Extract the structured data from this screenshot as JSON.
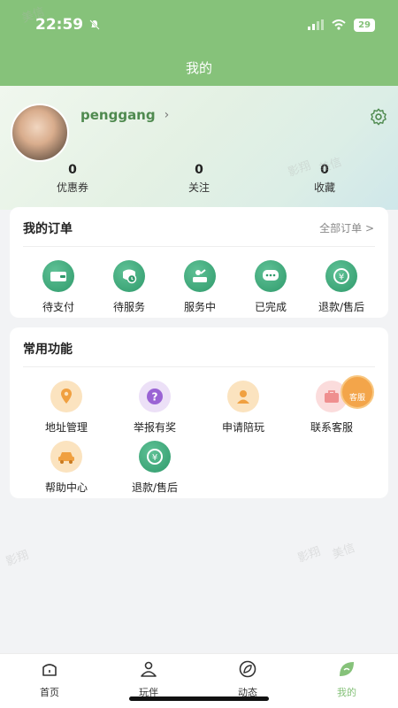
{
  "status_bar": {
    "time": "22:59",
    "battery": "29"
  },
  "header": {
    "title": "我的"
  },
  "profile": {
    "username": "penggang",
    "stats": [
      {
        "value": "0",
        "label": "优惠券"
      },
      {
        "value": "0",
        "label": "关注"
      },
      {
        "value": "0",
        "label": "收藏"
      }
    ]
  },
  "orders": {
    "title": "我的订单",
    "all_link": "全部订单 >",
    "items": [
      {
        "label": "待支付",
        "icon": "wallet-icon"
      },
      {
        "label": "待服务",
        "icon": "clock-icon"
      },
      {
        "label": "服务中",
        "icon": "service-icon"
      },
      {
        "label": "已完成",
        "icon": "chat-dots-icon"
      },
      {
        "label": "退款/售后",
        "icon": "yen-refund-icon"
      }
    ]
  },
  "functions": {
    "title": "常用功能",
    "items": [
      {
        "label": "地址管理",
        "icon": "location-pin-icon"
      },
      {
        "label": "举报有奖",
        "icon": "question-icon"
      },
      {
        "label": "申请陪玩",
        "icon": "person-icon"
      },
      {
        "label": "联系客服",
        "icon": "customer-service-icon",
        "badge": "客服"
      },
      {
        "label": "帮助中心",
        "icon": "help-car-icon"
      },
      {
        "label": "退款/售后",
        "icon": "yen-refund-icon"
      }
    ]
  },
  "watermark": [
    "美信",
    "影翔"
  ],
  "tabbar": {
    "items": [
      {
        "label": "首页",
        "icon": "home-icon"
      },
      {
        "label": "玩伴",
        "icon": "companion-icon"
      },
      {
        "label": "动态",
        "icon": "leaf-icon"
      },
      {
        "label": "我的",
        "icon": "profile-leaf-icon",
        "active": true
      }
    ]
  },
  "colors": {
    "primary": "#86c27a",
    "icon_green": "#2f9a6b",
    "accent_orange": "#f3a54a"
  }
}
